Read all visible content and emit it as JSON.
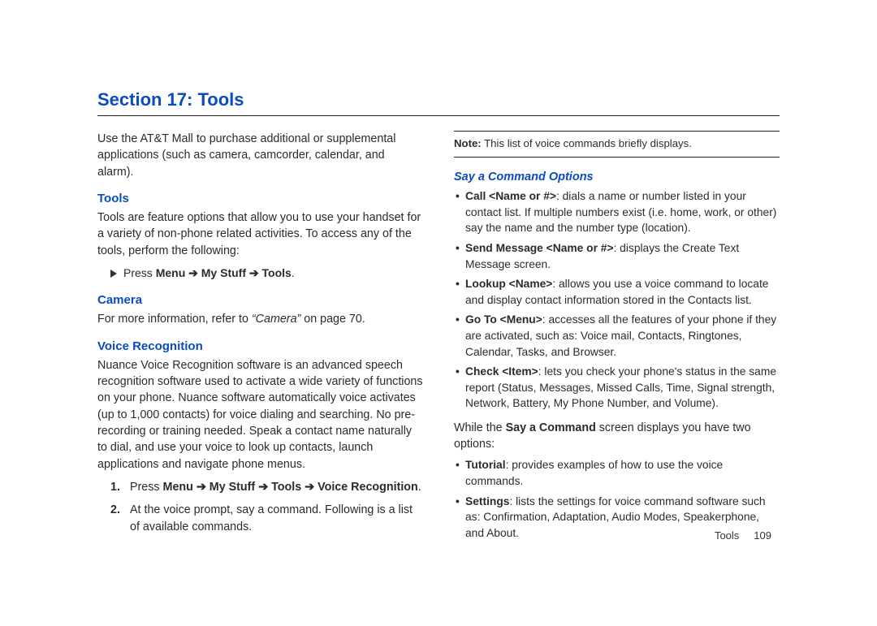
{
  "section_title": "Section 17: Tools",
  "left": {
    "intro": "Use the AT&T Mall to purchase additional or supplemental applications (such as camera, camcorder, calendar, and alarm).",
    "tools_heading": "Tools",
    "tools_body": "Tools are feature options that allow you to use your handset for a variety of non-phone related activities. To access any of the tools, perform the following:",
    "nav_press": "Press ",
    "nav_menu": "Menu",
    "nav_arrow": " ➔ ",
    "nav_mystuff": "My Stuff",
    "nav_tools": "Tools",
    "nav_period": ".",
    "camera_heading": "Camera",
    "camera_body_pre": "For more information, refer to ",
    "camera_ref": "“Camera”",
    "camera_body_post": "  on page 70.",
    "voice_heading": "Voice Recognition",
    "voice_body": "Nuance Voice Recognition software is an advanced speech recognition software used to activate a wide variety of functions on your phone. Nuance software automatically voice activates (up to 1,000 contacts) for voice dialing and searching. No pre-recording or training needed. Speak a contact name naturally to dial, and use your voice to look up contacts, launch applications and navigate phone menus.",
    "steps": [
      {
        "num": "1.",
        "pre": "Press ",
        "b1": "Menu",
        "arr": " ➔ ",
        "b2": "My Stuff",
        "b3": "Tools",
        "b4": "Voice Recognition",
        "post": "."
      },
      {
        "num": "2.",
        "text": "At the voice prompt, say a command. Following is a list of available commands."
      }
    ]
  },
  "right": {
    "note_label": "Note:",
    "note_text": " This list of voice commands briefly displays.",
    "say_heading": "Say a Command Options",
    "bullets1": [
      {
        "b": "Call <Name or #>",
        "t": ": dials a name or number listed in your contact list. If multiple numbers exist (i.e. home, work, or other) say the name and the number type (location)."
      },
      {
        "b": "Send Message <Name or #>",
        "t": ": displays the Create Text Message screen."
      },
      {
        "b": "Lookup <Name>",
        "t": ": allows you use a voice command to locate and display contact information stored in the Contacts list."
      },
      {
        "b": "Go To <Menu>",
        "t": ": accesses all the features of your phone if they are activated, such as: Voice mail, Contacts, Ringtones, Calendar, Tasks, and Browser."
      },
      {
        "b": "Check <Item>",
        "t": ": lets you check your phone's status in the same report (Status, Messages, Missed Calls, Time, Signal strength, Network, Battery, My Phone Number, and Volume)."
      }
    ],
    "mid_pre": "While the ",
    "mid_b": "Say a Command",
    "mid_post": " screen displays you have two options:",
    "bullets2": [
      {
        "b": "Tutorial",
        "t": ": provides examples of how to use the voice commands."
      },
      {
        "b": "Settings",
        "t": ": lists the settings for voice command software such as: Confirmation, Adaptation, Audio Modes, Speakerphone, and About."
      }
    ]
  },
  "footer": {
    "label": "Tools",
    "page": "109"
  }
}
